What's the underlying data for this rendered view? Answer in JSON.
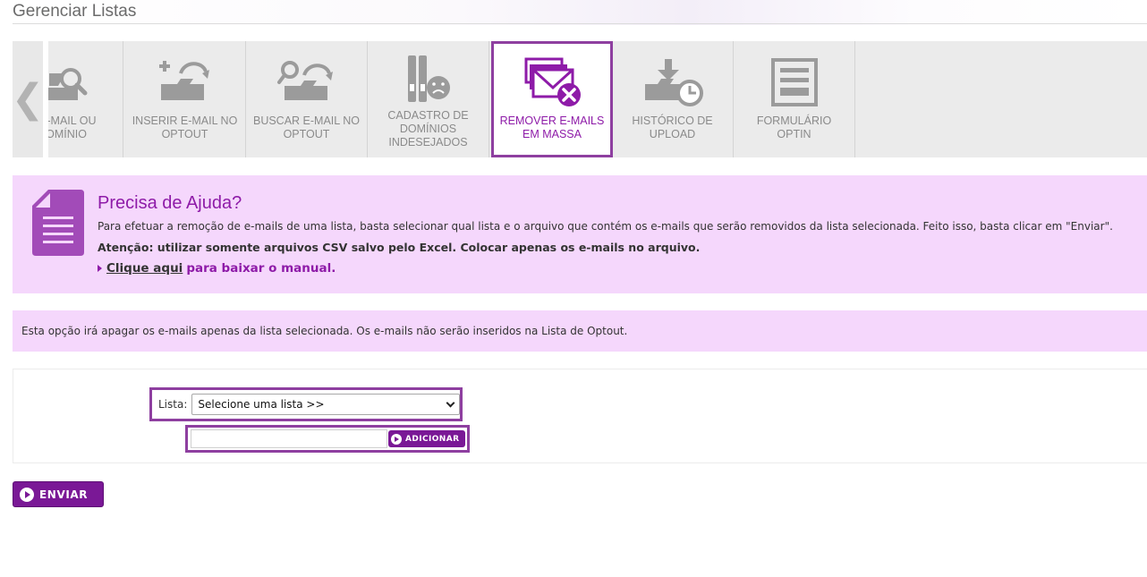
{
  "page": {
    "title": "Gerenciar Listas"
  },
  "carousel": {
    "prev_arrow": "❮",
    "tabs": [
      {
        "label": "R E-MAIL OU DOMÍNIO",
        "icon": "search-folder-icon",
        "active": false
      },
      {
        "label": "INSERIR E-MAIL NO OPTOUT",
        "icon": "insert-optout-icon",
        "active": false
      },
      {
        "label": "BUSCAR E-MAIL NO OPTOUT",
        "icon": "search-optout-icon",
        "active": false
      },
      {
        "label": "CADASTRO DE DOMÍNIOS INDESEJADOS",
        "icon": "unwanted-domains-icon",
        "active": false
      },
      {
        "label": "REMOVER E-MAILS EM MASSA",
        "icon": "remove-mass-emails-icon",
        "active": true
      },
      {
        "label": "HISTÓRICO DE UPLOAD",
        "icon": "upload-history-icon",
        "active": false
      },
      {
        "label": "FORMULÁRIO OPTIN",
        "icon": "optin-form-icon",
        "active": false
      }
    ]
  },
  "help": {
    "title": "Precisa de Ajuda?",
    "text": "Para efetuar a remoção de e-mails de uma lista, basta selecionar qual lista e o arquivo que contém os e-mails que serão removidos da lista selecionada. Feito isso, basta clicar em \"Enviar\".",
    "warning": "Atenção: utilizar somente arquivos CSV salvo pelo Excel. Colocar apenas os e-mails no arquivo.",
    "manual_link": "Clique aqui",
    "manual_rest": "para baixar o manual."
  },
  "info": {
    "text": "Esta opção irá apagar os e-mails apenas da lista selecionada. Os e-mails não serão inseridos na Lista de Optout."
  },
  "form": {
    "list_label": "Lista:",
    "list_selected": "Selecione uma lista >>",
    "file_value": "",
    "add_label": "ADICIONAR"
  },
  "send_label": "ENVIAR",
  "colors": {
    "accent": "#8e1ba8",
    "button": "#7a1896",
    "help_bg": "#f5d7fc",
    "tab_bg": "#ebebeb"
  }
}
